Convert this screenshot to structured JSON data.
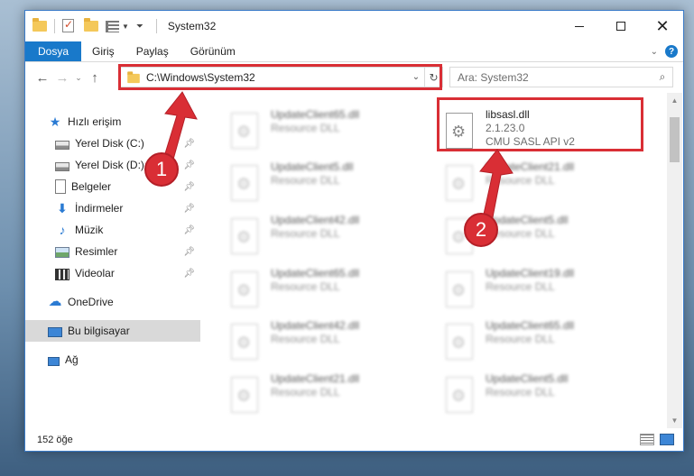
{
  "window": {
    "title": "System32"
  },
  "titlebar": {
    "minimize_icon": "minimize-icon",
    "maximize_icon": "maximize-icon",
    "close_icon": "close-icon"
  },
  "ribbon": {
    "tabs": [
      {
        "label": "Dosya",
        "active": true
      },
      {
        "label": "Giriş"
      },
      {
        "label": "Paylaş"
      },
      {
        "label": "Görünüm"
      }
    ],
    "help": "?"
  },
  "address_bar": {
    "path": "C:\\Windows\\System32",
    "refresh": "↻"
  },
  "search": {
    "placeholder": "Ara: System32"
  },
  "sidebar": {
    "items": [
      {
        "label": "Hızlı erişim",
        "icon": "star-icon"
      },
      {
        "label": "Yerel Disk (C:)",
        "icon": "disk-icon",
        "pinned": true
      },
      {
        "label": "Yerel Disk (D:)",
        "icon": "disk-icon",
        "pinned": true
      },
      {
        "label": "Belgeler",
        "icon": "documents-icon",
        "pinned": true
      },
      {
        "label": "İndirmeler",
        "icon": "downloads-icon",
        "pinned": true
      },
      {
        "label": "Müzik",
        "icon": "music-icon",
        "pinned": true
      },
      {
        "label": "Resimler",
        "icon": "pictures-icon",
        "pinned": true
      },
      {
        "label": "Videolar",
        "icon": "videos-icon",
        "pinned": true
      },
      {
        "label": "OneDrive",
        "icon": "cloud-icon"
      },
      {
        "label": "Bu bilgisayar",
        "icon": "computer-icon",
        "selected": true
      },
      {
        "label": "Ağ",
        "icon": "network-icon"
      }
    ]
  },
  "files": [
    {
      "name": "UpdateClient65.dll",
      "type": "Resource DLL"
    },
    {
      "name": "libsasl.dll",
      "version": "2.1.23.0",
      "description": "CMU SASL API v2",
      "highlighted": true
    },
    {
      "name": "UpdateClient5.dll",
      "type": "Resource DLL"
    },
    {
      "name": "UpdateClient21.dll",
      "type": "Resource DLL"
    },
    {
      "name": "UpdateClient42.dll",
      "type": "Resource DLL"
    },
    {
      "name": "UpdateClient5.dll",
      "type": "Resource DLL"
    },
    {
      "name": "UpdateClient65.dll",
      "type": "Resource DLL"
    },
    {
      "name": "UpdateClient19.dll",
      "type": "Resource DLL"
    },
    {
      "name": "UpdateClient42.dll",
      "type": "Resource DLL"
    },
    {
      "name": "UpdateClient65.dll",
      "type": "Resource DLL"
    },
    {
      "name": "UpdateClient21.dll",
      "type": "Resource DLL"
    },
    {
      "name": "UpdateClient5.dll",
      "type": "Resource DLL"
    }
  ],
  "status": {
    "item_count": "152 öğe"
  },
  "annotations": {
    "step1": "1",
    "step2": "2",
    "color": "#d92e35"
  }
}
